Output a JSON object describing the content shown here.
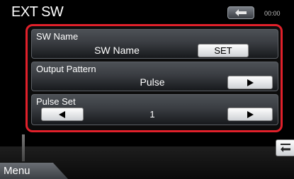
{
  "header": {
    "title": "EXT SW",
    "clock": "00:00"
  },
  "settings": {
    "sw_name": {
      "label": "SW  Name",
      "value": "SW Name",
      "button": "SET"
    },
    "output_pattern": {
      "label": "Output Pattern",
      "value": "Pulse"
    },
    "pulse_set": {
      "label": "Pulse Set",
      "value": "1"
    }
  },
  "footer": {
    "menu_label": "Menu"
  },
  "icons": {
    "back": "back-arrow-icon",
    "prev": "left-triangle-icon",
    "next": "right-triangle-icon",
    "collapse": "collapse-icon"
  },
  "colors": {
    "highlight_border": "#e0202a"
  }
}
